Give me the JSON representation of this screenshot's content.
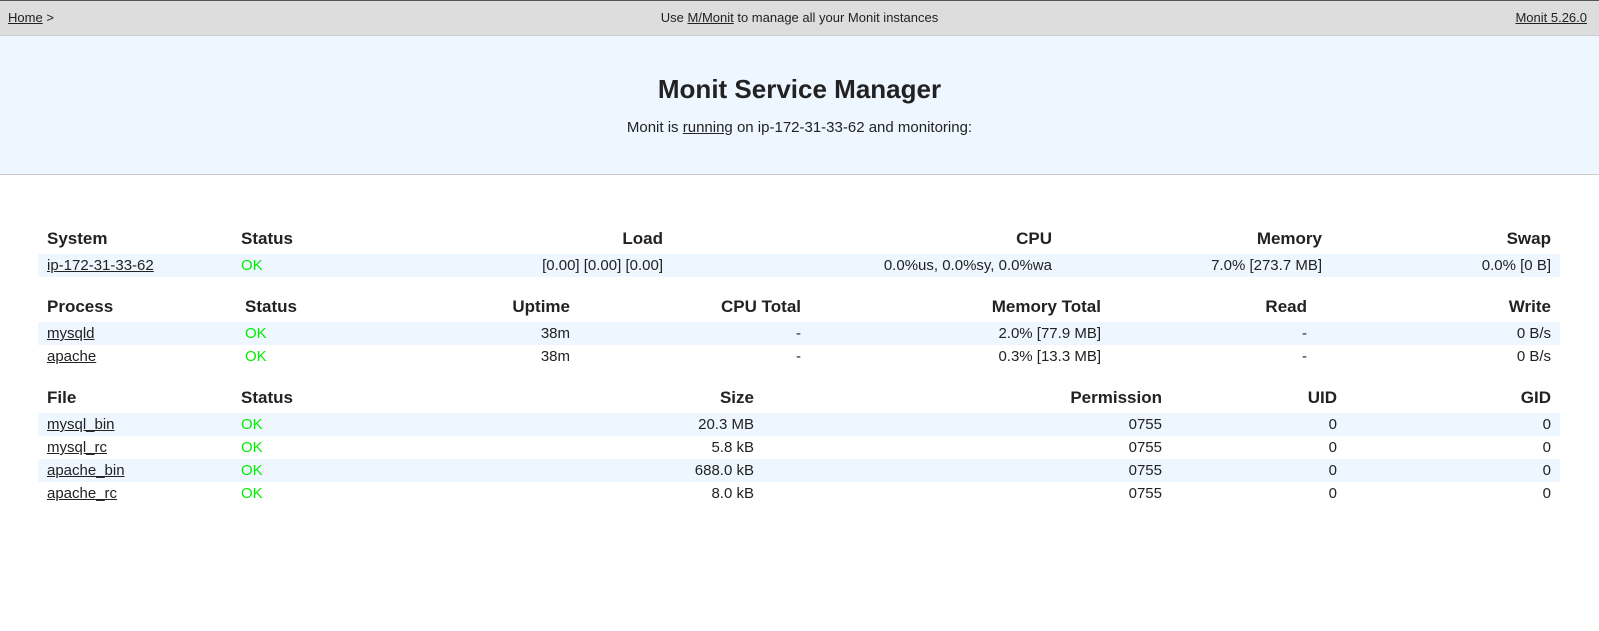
{
  "topbar": {
    "home_label": "Home",
    "separator": ">",
    "center_prefix": "Use ",
    "center_link": "M/Monit",
    "center_suffix": " to manage all your Monit instances",
    "version": "Monit 5.26.0"
  },
  "header": {
    "title": "Monit Service Manager",
    "subtitle_prefix": "Monit is ",
    "subtitle_link": "running",
    "subtitle_suffix": " on ip-172-31-33-62 and monitoring:"
  },
  "system_table": {
    "columns": [
      "System",
      "Status",
      "Load",
      "CPU",
      "Memory",
      "Swap"
    ],
    "rows": [
      {
        "name": "ip-172-31-33-62",
        "status": "OK",
        "load": "[0.00] [0.00] [0.00]",
        "cpu": "0.0%us, 0.0%sy, 0.0%wa",
        "memory": "7.0% [273.7 MB]",
        "swap": "0.0% [0 B]"
      }
    ]
  },
  "process_table": {
    "columns": [
      "Process",
      "Status",
      "Uptime",
      "CPU Total",
      "Memory Total",
      "Read",
      "Write"
    ],
    "rows": [
      {
        "name": "mysqld",
        "status": "OK",
        "uptime": "38m",
        "cpu_total": "-",
        "memory_total": "2.0% [77.9 MB]",
        "read": "-",
        "write": "0 B/s"
      },
      {
        "name": "apache",
        "status": "OK",
        "uptime": "38m",
        "cpu_total": "-",
        "memory_total": "0.3% [13.3 MB]",
        "read": "-",
        "write": "0 B/s"
      }
    ]
  },
  "file_table": {
    "columns": [
      "File",
      "Status",
      "Size",
      "Permission",
      "UID",
      "GID"
    ],
    "rows": [
      {
        "name": "mysql_bin",
        "status": "OK",
        "size": "20.3 MB",
        "permission": "0755",
        "uid": "0",
        "gid": "0"
      },
      {
        "name": "mysql_rc",
        "status": "OK",
        "size": "5.8 kB",
        "permission": "0755",
        "uid": "0",
        "gid": "0"
      },
      {
        "name": "apache_bin",
        "status": "OK",
        "size": "688.0 kB",
        "permission": "0755",
        "uid": "0",
        "gid": "0"
      },
      {
        "name": "apache_rc",
        "status": "OK",
        "size": "8.0 kB",
        "permission": "0755",
        "uid": "0",
        "gid": "0"
      }
    ]
  },
  "colors": {
    "topbar_bg": "#dddddd",
    "hero_bg": "#eef6ff",
    "row_stripe": "#eef6ff",
    "status_ok": "#00ee00"
  }
}
